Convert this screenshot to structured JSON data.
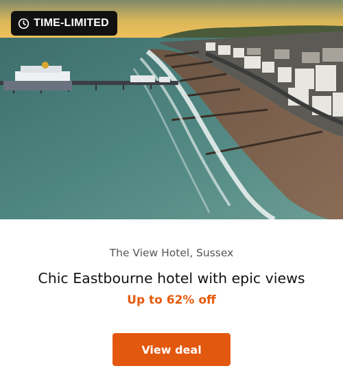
{
  "badge": {
    "label": "TIME-LIMITED",
    "icon": "clock-icon"
  },
  "hotel": {
    "location": "The View Hotel, Sussex",
    "headline": "Chic Eastbourne hotel with epic views",
    "discount": "Up to 62% off"
  },
  "actions": {
    "view_deal_label": "View deal"
  },
  "colors": {
    "accent": "#e2580f",
    "badge_bg": "#111111"
  }
}
